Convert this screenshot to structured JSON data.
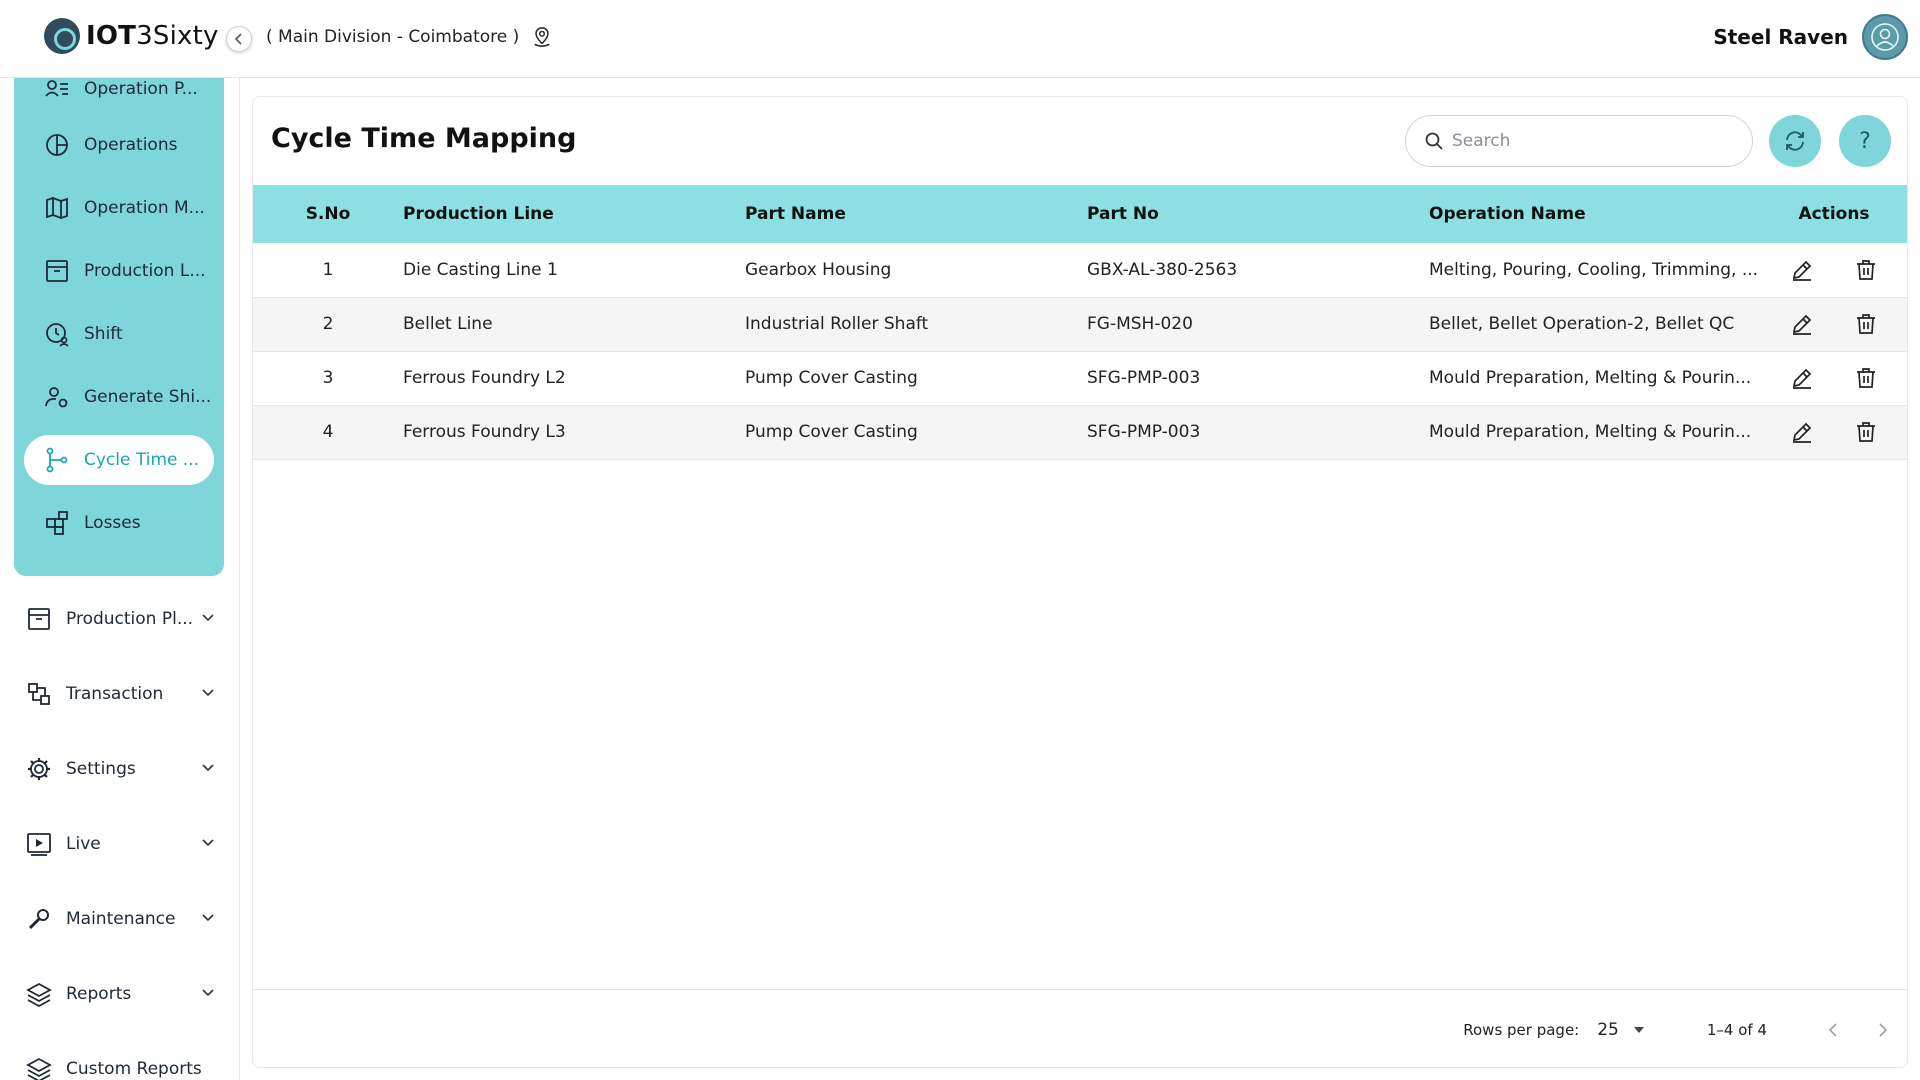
{
  "header": {
    "brand_bold": "IOT",
    "brand_light": "3Sixty",
    "division": "( Main Division - Coimbatore )",
    "user_name": "Steel Raven"
  },
  "sidebar": {
    "sub_items": [
      {
        "label": "Operation P...",
        "icon": "user-list-icon"
      },
      {
        "label": "Operations",
        "icon": "pie-chart-icon"
      },
      {
        "label": "Operation M...",
        "icon": "map-icon"
      },
      {
        "label": "Production L...",
        "icon": "archive-icon"
      },
      {
        "label": "Shift",
        "icon": "clock-user-icon"
      },
      {
        "label": "Generate Shi...",
        "icon": "user-gear-icon"
      },
      {
        "label": "Cycle Time ...",
        "icon": "flow-icon",
        "active": true
      },
      {
        "label": "Losses",
        "icon": "blocks-icon"
      }
    ],
    "main_items": [
      {
        "label": "Production Pl...",
        "icon": "archive-icon"
      },
      {
        "label": "Transaction",
        "icon": "transaction-icon"
      },
      {
        "label": "Settings",
        "icon": "gear-icon"
      },
      {
        "label": "Live",
        "icon": "play-icon"
      },
      {
        "label": "Maintenance",
        "icon": "wrench-icon"
      },
      {
        "label": "Reports",
        "icon": "layers-icon"
      },
      {
        "label": "Custom Reports",
        "icon": "layers-icon"
      }
    ]
  },
  "main": {
    "title": "Cycle Time Mapping",
    "search_placeholder": "Search",
    "refresh_icon": "refresh-icon",
    "help_label": "?",
    "columns": [
      "S.No",
      "Production Line",
      "Part Name",
      "Part No",
      "Operation Name",
      "Actions"
    ],
    "rows": [
      {
        "sno": "1",
        "line": "Die Casting Line 1",
        "part": "Gearbox Housing",
        "part_no": "GBX-AL-380-2563",
        "ops": "Melting, Pouring, Cooling, Trimming, ..."
      },
      {
        "sno": "2",
        "line": "Bellet Line",
        "part": "Industrial Roller Shaft",
        "part_no": "FG-MSH-020",
        "ops": "Bellet, Bellet Operation-2, Bellet QC"
      },
      {
        "sno": "3",
        "line": "Ferrous Foundry L2",
        "part": "Pump Cover Casting",
        "part_no": "SFG-PMP-003",
        "ops": "Mould Preparation, Melting & Pourin..."
      },
      {
        "sno": "4",
        "line": "Ferrous Foundry L3",
        "part": "Pump Cover Casting",
        "part_no": "SFG-PMP-003",
        "ops": "Mould Preparation, Melting & Pourin..."
      }
    ],
    "footer": {
      "rows_per_page_label": "Rows per page:",
      "rows_per_page_value": "25",
      "range": "1–4 of 4"
    }
  },
  "colors": {
    "accent": "#7fd6da",
    "header_row": "#8ce0e3",
    "active_text": "#17a8b5"
  }
}
